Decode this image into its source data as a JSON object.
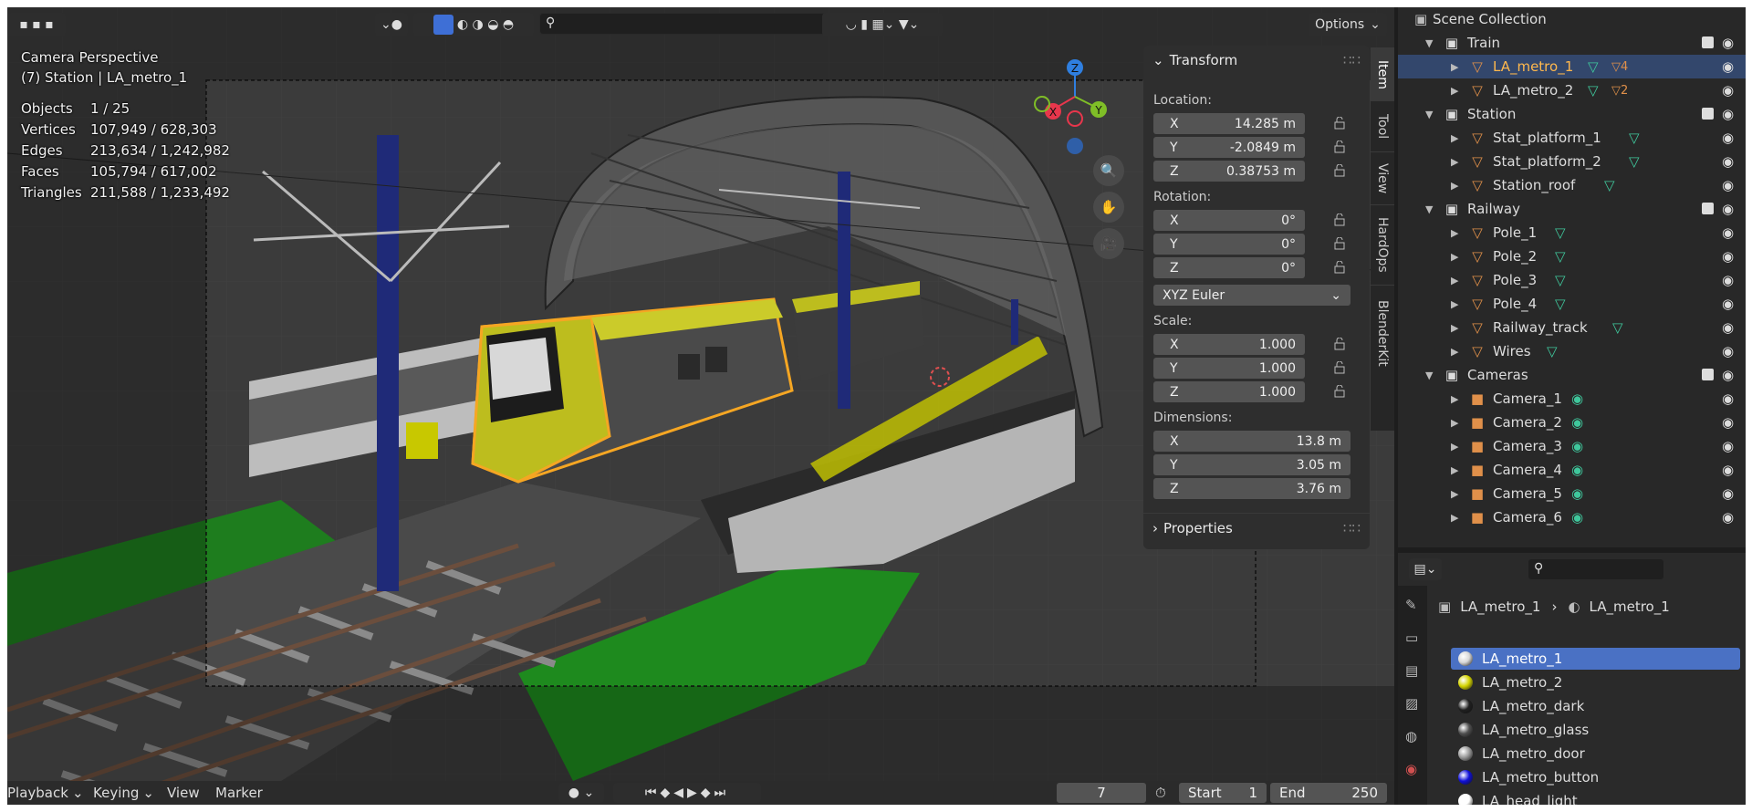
{
  "viewport": {
    "view_name": "Camera Perspective",
    "context": "(7) Station | LA_metro_1",
    "stats": [
      {
        "label": "Objects",
        "value": "1 / 25"
      },
      {
        "label": "Vertices",
        "value": "107,949 / 628,303"
      },
      {
        "label": "Edges",
        "value": "213,634 / 1,242,982"
      },
      {
        "label": "Faces",
        "value": "105,794 / 617,002"
      },
      {
        "label": "Triangles",
        "value": "211,588 / 1,233,492"
      }
    ],
    "options_label": "Options",
    "gizmo": {
      "x": "X",
      "y": "Y",
      "z": "Z"
    },
    "colors": {
      "x_axis": "#e8364c",
      "y_axis": "#7fbe27",
      "z_axis": "#2f7fe0",
      "selection": "#f5a623"
    }
  },
  "npanel": {
    "transform_title": "Transform",
    "location_label": "Location:",
    "location": [
      {
        "axis": "X",
        "value": "14.285 m"
      },
      {
        "axis": "Y",
        "value": "-2.0849 m"
      },
      {
        "axis": "Z",
        "value": "0.38753 m"
      }
    ],
    "rotation_label": "Rotation:",
    "rotation": [
      {
        "axis": "X",
        "value": "0°"
      },
      {
        "axis": "Y",
        "value": "0°"
      },
      {
        "axis": "Z",
        "value": "0°"
      }
    ],
    "rotation_mode": "XYZ Euler",
    "scale_label": "Scale:",
    "scale": [
      {
        "axis": "X",
        "value": "1.000"
      },
      {
        "axis": "Y",
        "value": "1.000"
      },
      {
        "axis": "Z",
        "value": "1.000"
      }
    ],
    "dimensions_label": "Dimensions:",
    "dimensions": [
      {
        "axis": "X",
        "value": "13.8 m"
      },
      {
        "axis": "Y",
        "value": "3.05 m"
      },
      {
        "axis": "Z",
        "value": "3.76 m"
      }
    ],
    "properties_title": "Properties",
    "tabs": [
      "Item",
      "Tool",
      "View",
      "HardOps",
      "BlenderKit"
    ]
  },
  "outliner": {
    "root": "Scene Collection",
    "rows": [
      {
        "name": "Train",
        "type": "collection",
        "depth": 0
      },
      {
        "name": "LA_metro_1",
        "type": "mesh",
        "depth": 1,
        "selected": true,
        "badge": "4"
      },
      {
        "name": "LA_metro_2",
        "type": "mesh",
        "depth": 1,
        "badge": "2"
      },
      {
        "name": "Station",
        "type": "collection",
        "depth": 0
      },
      {
        "name": "Stat_platform_1",
        "type": "mesh",
        "depth": 1
      },
      {
        "name": "Stat_platform_2",
        "type": "mesh",
        "depth": 1
      },
      {
        "name": "Station_roof",
        "type": "mesh",
        "depth": 1
      },
      {
        "name": "Railway",
        "type": "collection",
        "depth": 0
      },
      {
        "name": "Pole_1",
        "type": "mesh",
        "depth": 1
      },
      {
        "name": "Pole_2",
        "type": "mesh",
        "depth": 1
      },
      {
        "name": "Pole_3",
        "type": "mesh",
        "depth": 1
      },
      {
        "name": "Pole_4",
        "type": "mesh",
        "depth": 1
      },
      {
        "name": "Railway_track",
        "type": "mesh",
        "depth": 1
      },
      {
        "name": "Wires",
        "type": "mesh",
        "depth": 1
      },
      {
        "name": "Cameras",
        "type": "collection",
        "depth": 0
      },
      {
        "name": "Camera_1",
        "type": "camera",
        "depth": 1
      },
      {
        "name": "Camera_2",
        "type": "camera",
        "depth": 1
      },
      {
        "name": "Camera_3",
        "type": "camera",
        "depth": 1
      },
      {
        "name": "Camera_4",
        "type": "camera",
        "depth": 1
      },
      {
        "name": "Camera_5",
        "type": "camera",
        "depth": 1
      },
      {
        "name": "Camera_6",
        "type": "camera",
        "depth": 1
      }
    ]
  },
  "properties": {
    "breadcrumb_object": "LA_metro_1",
    "breadcrumb_material": "LA_metro_1",
    "materials": [
      {
        "name": "LA_metro_1",
        "color": "#d8d8d8",
        "selected": true
      },
      {
        "name": "LA_metro_2",
        "color": "#d4d400"
      },
      {
        "name": "LA_metro_dark",
        "color": "#202020"
      },
      {
        "name": "LA_metro_glass",
        "color": "#505050"
      },
      {
        "name": "LA_metro_door",
        "color": "#9a9a9a"
      },
      {
        "name": "LA_metro_button",
        "color": "#1010d8"
      },
      {
        "name": "LA_head_light",
        "color": "#ffffff"
      }
    ]
  },
  "timeline": {
    "playback": "Playback",
    "keying": "Keying",
    "view": "View",
    "marker": "Marker",
    "current_frame": "7",
    "start_label": "Start",
    "start_value": "1",
    "end_label": "End",
    "end_value": "250"
  }
}
